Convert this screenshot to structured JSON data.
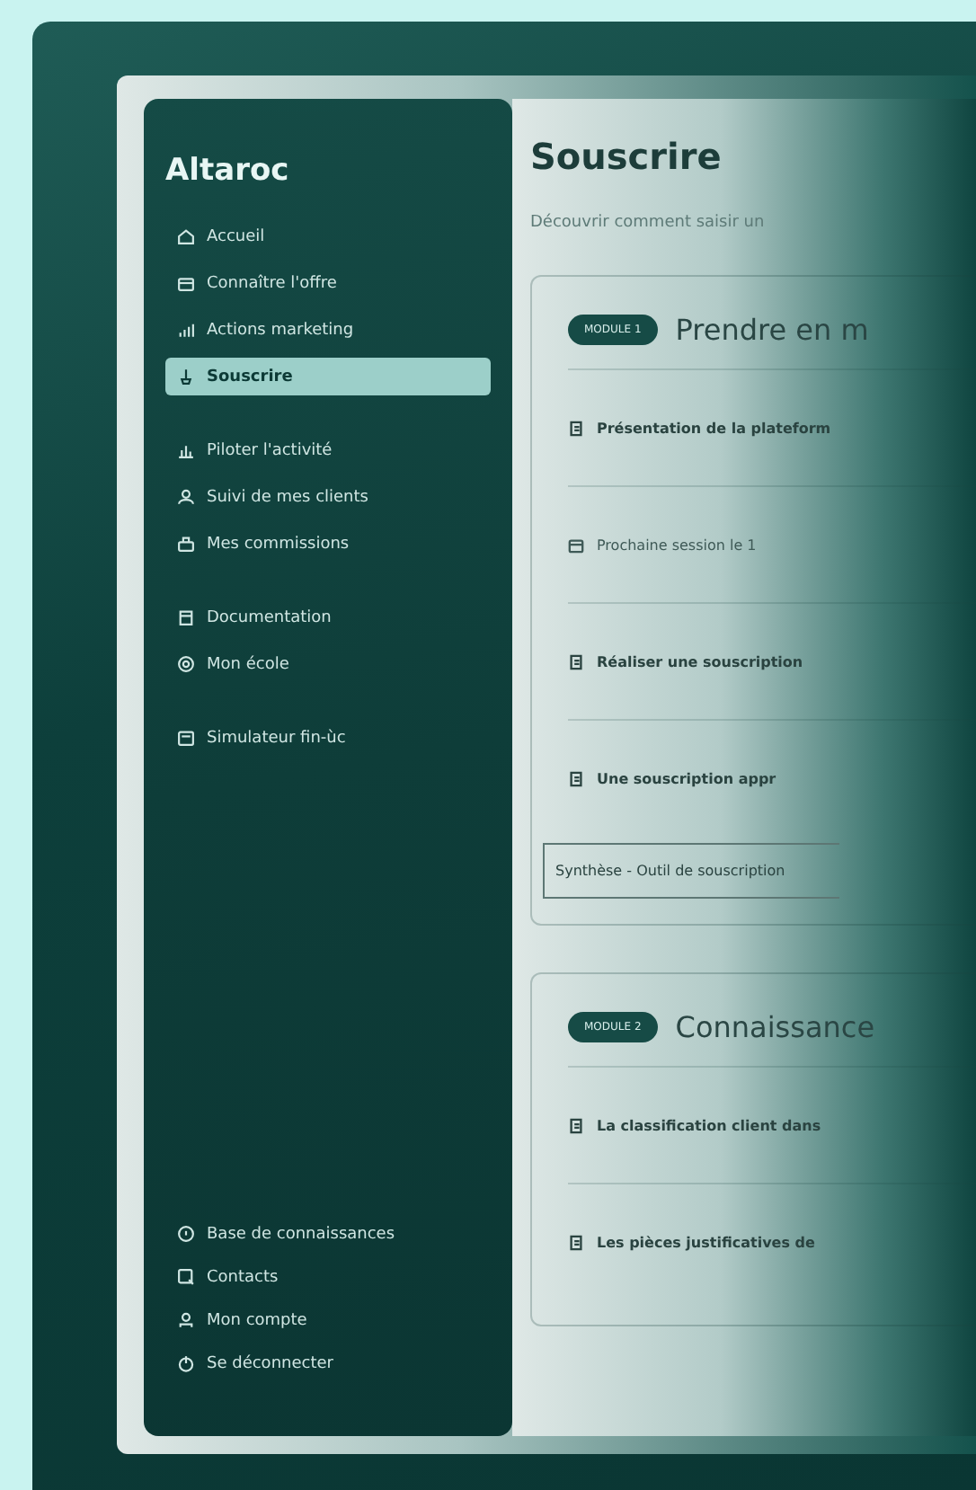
{
  "sidebar": {
    "logo": "Altaroc",
    "groups": [
      [
        {
          "label": "Accueil",
          "selected": false
        },
        {
          "label": "Connaître l'offre",
          "selected": false
        },
        {
          "label": "Actions marketing",
          "selected": false
        },
        {
          "label": "Souscrire",
          "selected": true
        }
      ],
      [
        {
          "label": "Piloter l'activité",
          "selected": false
        },
        {
          "label": "Suivi de mes clients",
          "selected": false
        },
        {
          "label": "Mes commissions",
          "selected": false
        }
      ],
      [
        {
          "label": "Documentation",
          "selected": false
        },
        {
          "label": "Mon école",
          "selected": false
        }
      ],
      [
        {
          "label": "Simulateur fin-ùc",
          "selected": false
        }
      ]
    ],
    "footer": [
      {
        "label": "Base de connaissances"
      },
      {
        "label": "Contacts"
      },
      {
        "label": "Mon compte"
      },
      {
        "label": "Se déconnecter"
      }
    ]
  },
  "page": {
    "title": "Souscrire",
    "subtitle": "Découvrir comment saisir un",
    "modules": [
      {
        "badge": "MODULE 1",
        "title": "Prendre en m",
        "items": [
          {
            "kind": "lesson",
            "label": "Présentation de la plateform"
          },
          {
            "kind": "session",
            "label": "Prochaine session le 1"
          },
          {
            "kind": "lesson",
            "label": "Réaliser une souscription"
          },
          {
            "kind": "lesson",
            "label": "Une souscription appr"
          }
        ],
        "summary": "Synthèse - Outil de souscription"
      },
      {
        "badge": "MODULE 2",
        "title": "Connaissance",
        "items": [
          {
            "kind": "lesson",
            "label": "La classification client dans"
          },
          {
            "kind": "lesson",
            "label": "Les pièces justificatives de"
          }
        ]
      }
    ]
  }
}
